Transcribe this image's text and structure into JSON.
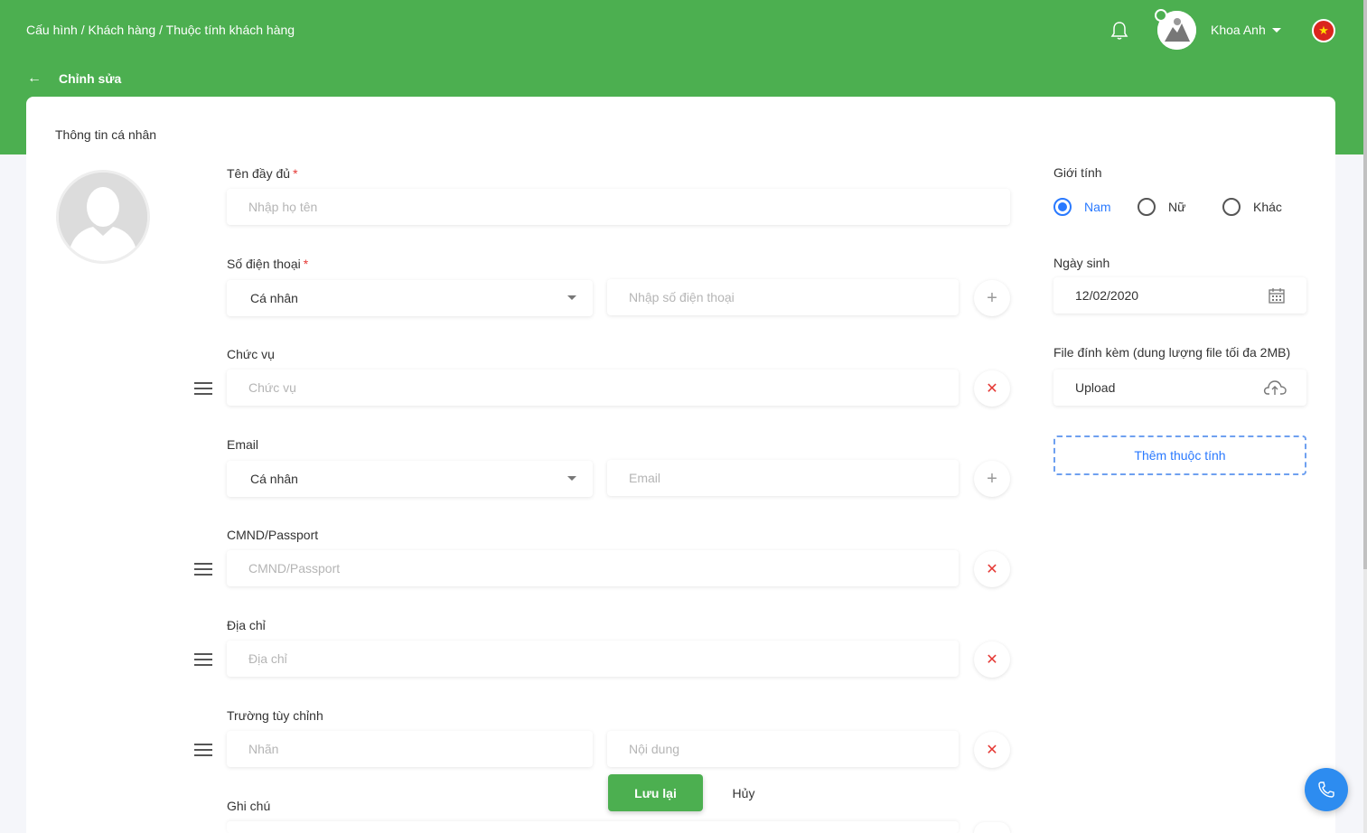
{
  "header": {
    "breadcrumb": "Cấu hình / Khách hàng / Thuộc tính khách hàng",
    "subtitle": "Chỉnh sửa",
    "username": "Khoa Anh",
    "flag_glyph": "★",
    "colors": {
      "primary": "#4caf50",
      "accent": "#2979ff",
      "danger": "#e53935"
    },
    "icons": [
      "back-arrow-icon",
      "bell-icon",
      "avatar",
      "chevron-down-icon",
      "vietnam-flag-icon"
    ]
  },
  "section_title": "Thông tin cá nhân",
  "form": {
    "fullname": {
      "label": "Tên đầy đủ",
      "required": "*",
      "placeholder": "Nhập họ tên"
    },
    "phone": {
      "label": "Số điện thoại",
      "required": "*",
      "type_value": "Cá nhân",
      "placeholder": "Nhập số điện thoại"
    },
    "position": {
      "label": "Chức vụ",
      "placeholder": "Chức vụ"
    },
    "email": {
      "label": "Email",
      "type_value": "Cá nhân",
      "placeholder": "Email"
    },
    "idcard": {
      "label": "CMND/Passport",
      "placeholder": "CMND/Passport"
    },
    "address": {
      "label": "Địa chỉ",
      "placeholder": "Địa chỉ"
    },
    "custom": {
      "label": "Trường tùy chỉnh",
      "key_placeholder": "Nhãn",
      "value_placeholder": "Nội dung"
    },
    "note": {
      "label": "Ghi chú"
    },
    "gender": {
      "label": "Giới tính",
      "options": [
        "Nam",
        "Nữ",
        "Khác"
      ],
      "selected": "Nam"
    },
    "birthday": {
      "label": "Ngày sinh",
      "value": "12/02/2020"
    },
    "attachment": {
      "label": "File đính kèm (dung lượng file tối đa 2MB)",
      "button": "Upload"
    },
    "add_attribute": "Thêm thuộc tính"
  },
  "actions": {
    "save": "Lưu lại",
    "cancel": "Hủy"
  },
  "glyphs": {
    "back": "←",
    "plus": "+",
    "remove": "✕"
  }
}
